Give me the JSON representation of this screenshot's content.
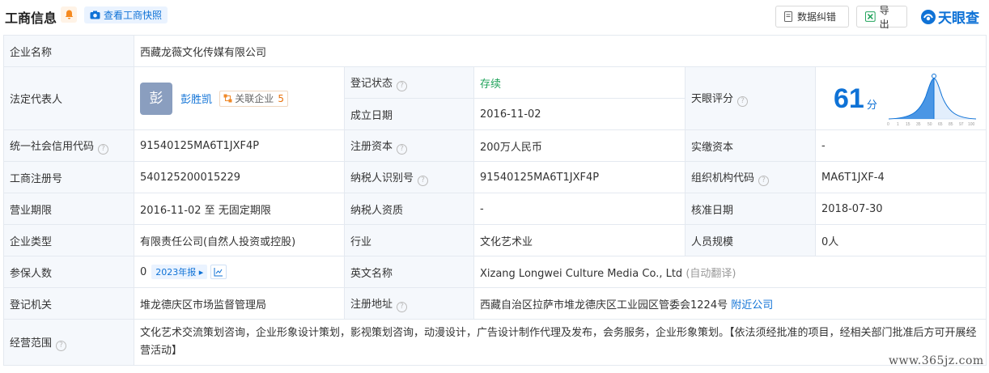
{
  "header": {
    "title": "工商信息",
    "snapshot_label": "查看工商快照",
    "report_error_label": "数据纠错",
    "export_label": "导出",
    "logo_text": "天眼查"
  },
  "rows": {
    "company_name": {
      "label": "企业名称",
      "value": "西藏龙薇文化传媒有限公司"
    },
    "legal_rep": {
      "label": "法定代表人",
      "avatar_char": "彭",
      "name": "彭胜凯",
      "assoc_label": "关联企业",
      "assoc_count": "5"
    },
    "reg_status": {
      "label": "登记状态",
      "value": "存续"
    },
    "found_date": {
      "label": "成立日期",
      "value": "2016-11-02"
    },
    "tianyan_score": {
      "label": "天眼评分",
      "value": "61",
      "unit": "分",
      "axis_ticks": [
        "0",
        "1",
        "15",
        "35",
        "50",
        "65",
        "85",
        "97",
        "100"
      ]
    },
    "credit_code": {
      "label": "统一社会信用代码",
      "value": "91540125MA6T1JXF4P"
    },
    "reg_capital": {
      "label": "注册资本",
      "value": "200万人民币"
    },
    "paid_capital": {
      "label": "实缴资本",
      "value": "-"
    },
    "reg_no": {
      "label": "工商注册号",
      "value": "540125200015229"
    },
    "taxpayer_id": {
      "label": "纳税人识别号",
      "value": "91540125MA6T1JXF4P"
    },
    "org_code": {
      "label": "组织机构代码",
      "value": "MA6T1JXF-4"
    },
    "biz_term": {
      "label": "营业期限",
      "value": "2016-11-02 至 无固定期限"
    },
    "taxpayer_qual": {
      "label": "纳税人资质",
      "value": "-"
    },
    "approve_date": {
      "label": "核准日期",
      "value": "2018-07-30"
    },
    "company_type": {
      "label": "企业类型",
      "value": "有限责任公司(自然人投资或控股)"
    },
    "industry": {
      "label": "行业",
      "value": "文化艺术业"
    },
    "staff_size": {
      "label": "人员规模",
      "value": "0人"
    },
    "insured": {
      "label": "参保人数",
      "value": "0",
      "report_label": "2023年报"
    },
    "english_name": {
      "label": "英文名称",
      "value": "Xizang Longwei Culture Media Co., Ltd",
      "note": "(自动翻译)"
    },
    "reg_authority": {
      "label": "登记机关",
      "value": "堆龙德庆区市场监督管理局"
    },
    "reg_address": {
      "label": "注册地址",
      "value": "西藏自治区拉萨市堆龙德庆区工业园区管委会1224号",
      "nearby_label": "附近公司"
    },
    "biz_scope": {
      "label": "经营范围",
      "value": "文化艺术交流策划咨询，企业形象设计策划，影视策划咨询，动漫设计，广告设计制作代理及发布，会务服务，企业形象策划。【依法须经批准的项目，经相关部门批准后方可开展经营活动】"
    }
  },
  "watermark": "www.365jz.com",
  "colors": {
    "accent": "#0f72d6",
    "status_green": "#21a35b",
    "label_bg": "#f5f8fc",
    "border": "#e4e9f0"
  }
}
